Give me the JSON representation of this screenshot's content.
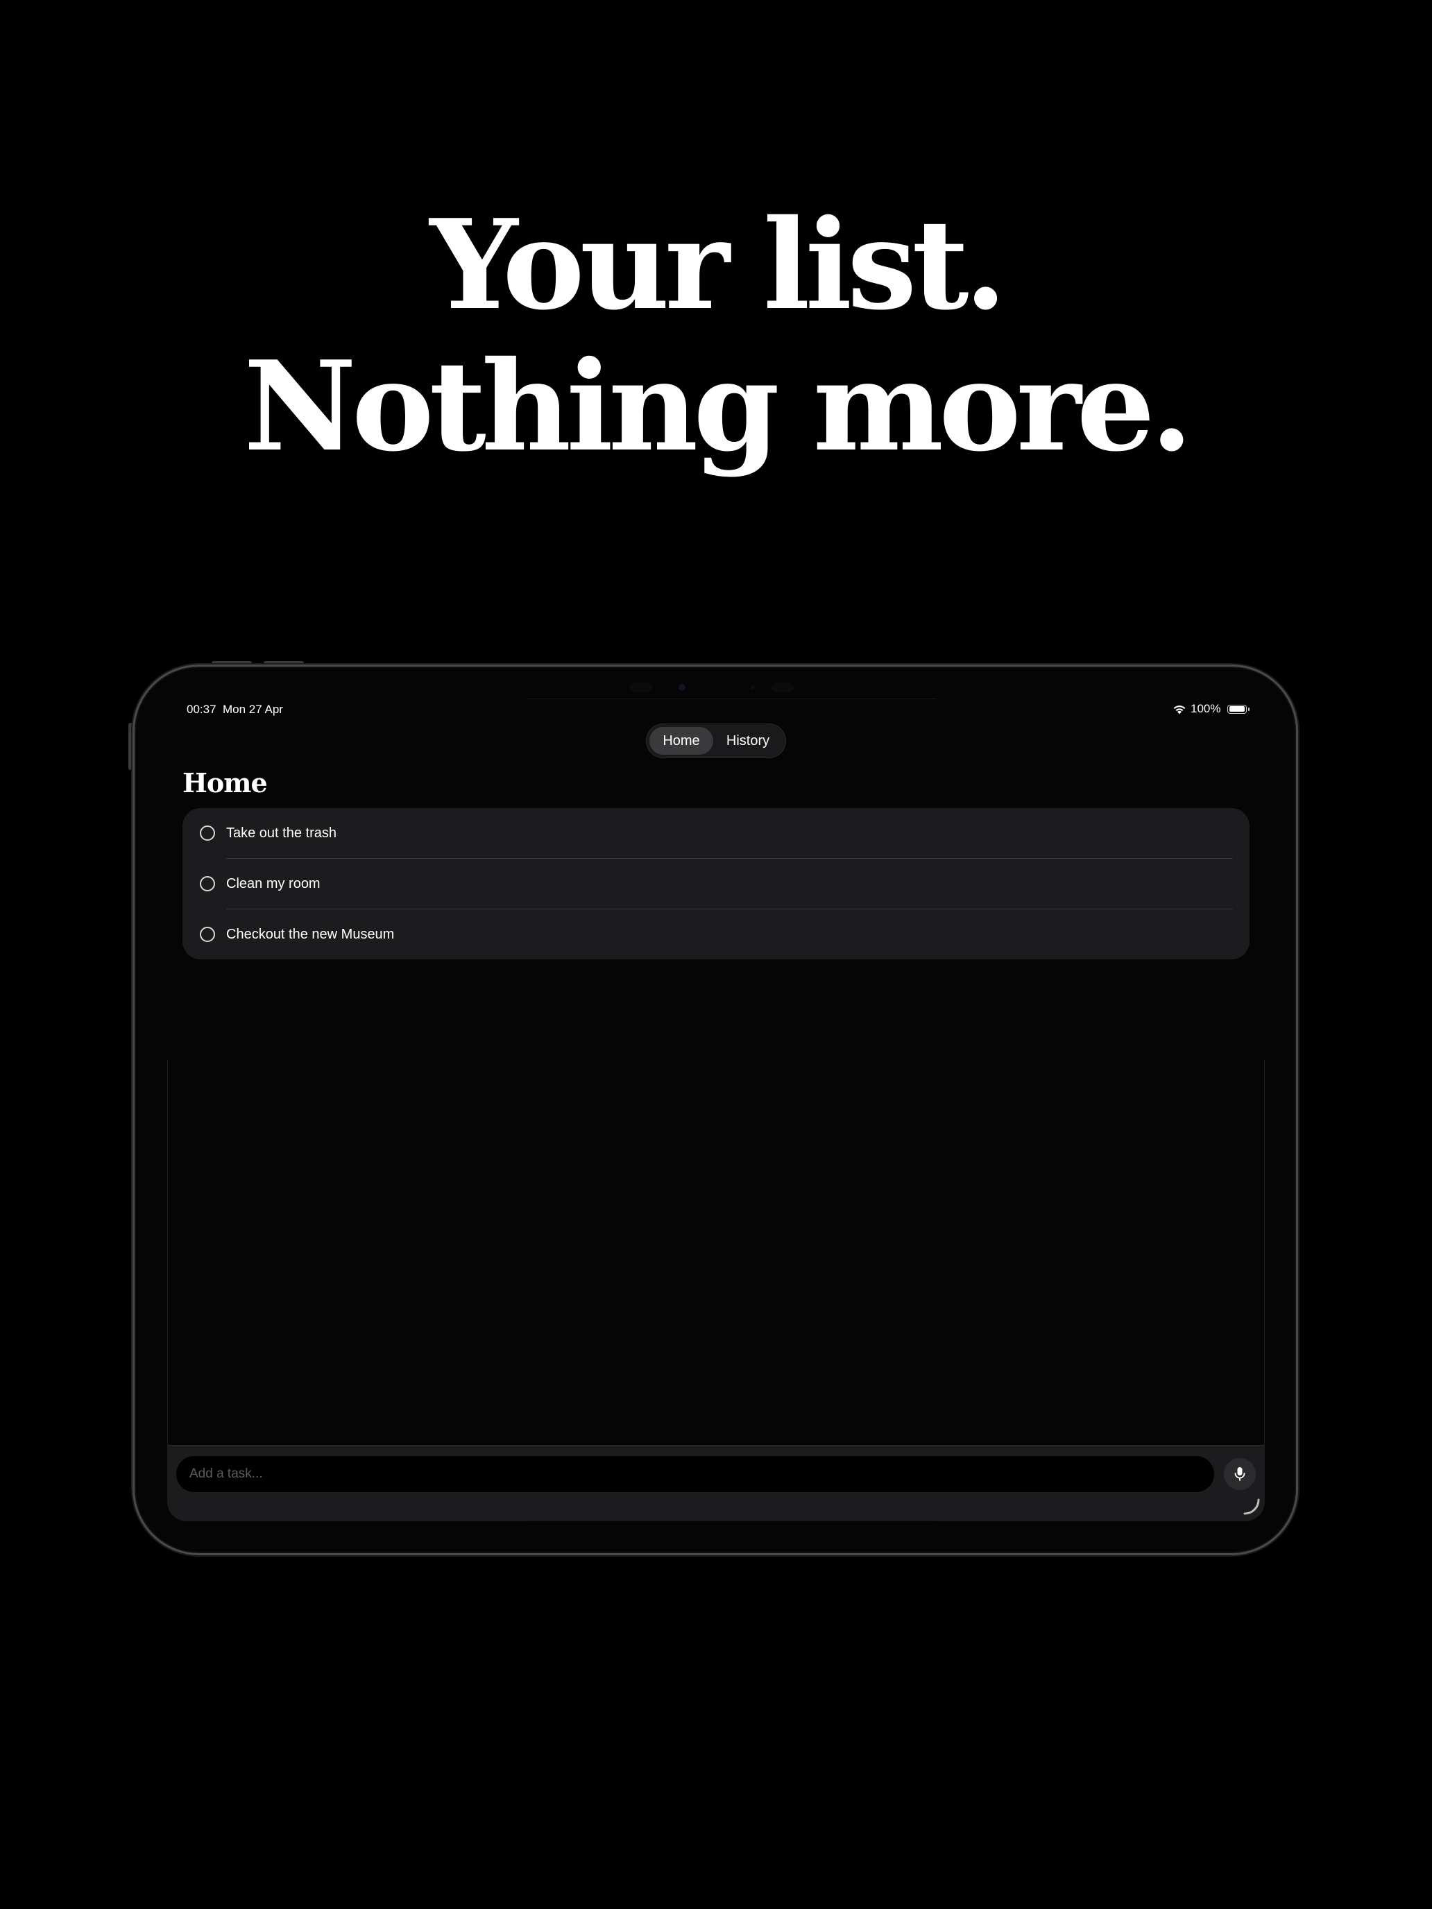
{
  "marketing": {
    "headline_line1": "Your list.",
    "headline_line2": "Nothing more."
  },
  "status_bar": {
    "time": "00:37",
    "date": "Mon 27 Apr",
    "battery": "100%",
    "battery_level": 1.0,
    "wifi_icon": "wifi-icon",
    "battery_icon": "battery-icon"
  },
  "nav": {
    "tabs": [
      {
        "label": "Home",
        "selected": true
      },
      {
        "label": "History",
        "selected": false
      }
    ]
  },
  "page": {
    "title": "Home"
  },
  "tasks": [
    {
      "label": "Take out the trash",
      "done": false
    },
    {
      "label": "Clean my room",
      "done": false
    },
    {
      "label": "Checkout the new Museum",
      "done": false
    }
  ],
  "composer": {
    "placeholder": "Add a task...",
    "value": "",
    "mic_icon": "microphone-icon"
  },
  "colors": {
    "background": "#000000",
    "card": "#1c1c1e",
    "selected_tab": "#3a3a3c",
    "text": "#ffffff",
    "placeholder": "#5a5a5e"
  }
}
